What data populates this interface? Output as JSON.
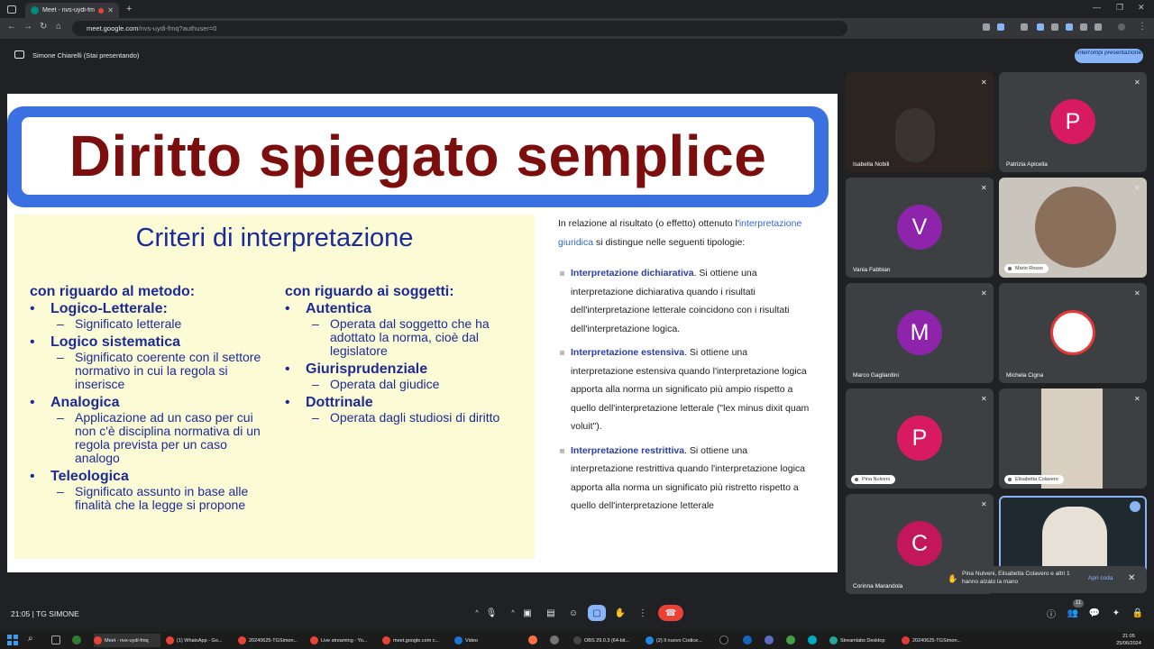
{
  "browser": {
    "tab_title": "Meet - nvs-uydi-fmq",
    "url_host": "meet.google.com",
    "url_path": "/nvs-uydi-fmq?authuser=0"
  },
  "meet": {
    "presenting_label": "Simone Chiarelli (Stai presentando)",
    "stop_presenting": "Interrompi presentazione",
    "clock": "21:05",
    "meeting_name": "TG SIMONE",
    "participants_count": "11"
  },
  "slide": {
    "banner_title": "Diritto spiegato semplice",
    "criteria_title": "Criteri di interpretazione",
    "left_column": {
      "heading": "con riguardo al metodo:",
      "items": [
        {
          "title": "Logico-Letterale:",
          "sub": "Significato letterale"
        },
        {
          "title": "Logico sistematica",
          "sub": "Significato coerente con il settore normativo in cui la regola si inserisce"
        },
        {
          "title": "Analogica",
          "sub": "Applicazione ad un caso per cui non c'è disciplina normativa di un regola prevista per un caso analogo"
        },
        {
          "title": "Teleologica",
          "sub": "Significato assunto in base alle finalità che la legge si propone"
        }
      ]
    },
    "right_column": {
      "heading": "con riguardo ai soggetti:",
      "items": [
        {
          "title": "Autentica",
          "sub": "Operata dal soggetto che ha adottato la norma, cioè dal legislatore"
        },
        {
          "title": "Giurisprudenziale",
          "sub": "Operata dal giudice"
        },
        {
          "title": "Dottrinale",
          "sub": "Operata dagli studiosi di diritto"
        }
      ]
    },
    "wiki": {
      "intro_pre": "In relazione al risultato (o effetto) ottenuto l'",
      "intro_link": "interpretazione giuridica",
      "intro_post": " si distingue nelle seguenti tipologie:",
      "bullets": [
        {
          "term": "Interpretazione dichiarativa",
          "text": ". Si ottiene una interpretazione dichiarativa quando i risultati dell'interpretazione letterale coincidono con i risultati dell'interpretazione logica."
        },
        {
          "term": "Interpretazione estensiva",
          "text": ". Si ottiene una interpretazione estensiva quando l'interpretazione logica apporta alla norma un significato più ampio rispetto a quello dell'interpretazione letterale (\"lex minus dixit quam voluit\")."
        },
        {
          "term": "Interpretazione restrittiva",
          "text": ". Si ottiene una interpretazione restrittiva quando l'interpretazione logica apporta alla norma un significato più ristretto rispetto a quello dell'interpretazione letterale"
        }
      ]
    }
  },
  "participants": [
    {
      "name": "Isabella Nobili",
      "initial": "",
      "color": ""
    },
    {
      "name": "Patrizia Apicella",
      "initial": "P",
      "color": "#d81b60"
    },
    {
      "name": "Vania Fabbian",
      "initial": "V",
      "color": "#8e24aa"
    },
    {
      "name": "Mario Rosso",
      "initial": "",
      "color": ""
    },
    {
      "name": "Marco Gagliardini",
      "initial": "M",
      "color": "#8e24aa"
    },
    {
      "name": "Michela Cigna",
      "initial": "",
      "color": ""
    },
    {
      "name": "Pina Nulveni",
      "initial": "P",
      "color": "#d81b60"
    },
    {
      "name": "Elisabetta Colavero",
      "initial": "",
      "color": ""
    },
    {
      "name": "Corinna Marandola",
      "initial": "C",
      "color": "#c2185b"
    }
  ],
  "toast": {
    "text": "Pina Nulveni, Elisabetta Colavero e altri 1 hanno alzato la mano",
    "action": "Apri coda"
  },
  "taskbar": {
    "apps": [
      "Meet - nvs-uydi-fmq",
      "(1) WhatsApp - Go...",
      "20240625-TGSimon...",
      "Live streaming - Yo...",
      "meet.google.com c...",
      "Video",
      "OBS 29.0.3 (64-bit...",
      "(2) Il nuovo Codice...",
      "Streamlabs Desktop",
      "20240625-TGSimon..."
    ],
    "time": "21:05",
    "date": "25/06/2024"
  }
}
